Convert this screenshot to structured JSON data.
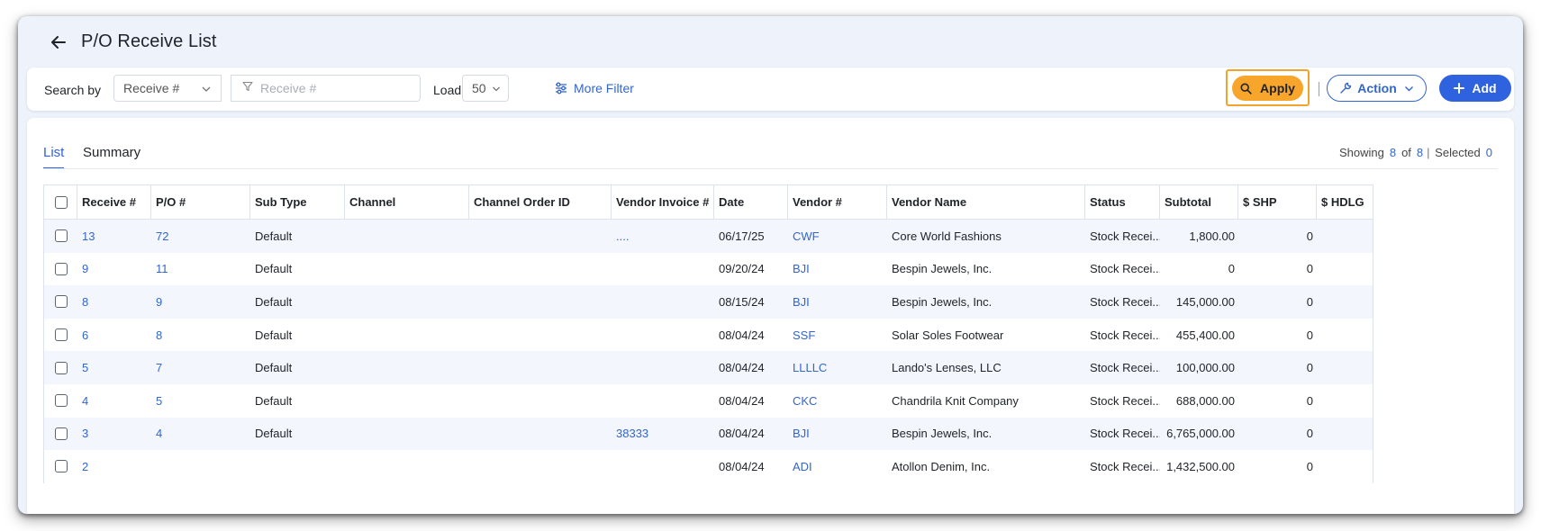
{
  "page": {
    "title": "P/O Receive List"
  },
  "toolbar": {
    "search_by_label": "Search by",
    "search_by_value": "Receive #",
    "search_placeholder": "Receive #",
    "load_label": "Load",
    "load_value": "50",
    "more_filter_label": "More Filter",
    "apply_label": "Apply",
    "action_label": "Action",
    "add_label": "Add"
  },
  "tabs": [
    {
      "label": "List"
    },
    {
      "label": "Summary"
    }
  ],
  "status": {
    "showing_label": "Showing",
    "showing_count": "8",
    "of_label": "of",
    "total_count": "8",
    "selected_label": "Selected",
    "selected_count": "0"
  },
  "table": {
    "columns": [
      "Receive #",
      "P/O #",
      "Sub Type",
      "Channel",
      "Channel Order ID",
      "Vendor Invoice #",
      "Date",
      "Vendor #",
      "Vendor Name",
      "Status",
      "Subtotal",
      "$ SHP",
      "$ HDLG"
    ],
    "rows": [
      {
        "receive": "13",
        "po": "72",
        "sub_type": "Default",
        "channel": "",
        "channel_order_id": "",
        "vendor_invoice": "....",
        "date": "06/17/25",
        "vendor_num": "CWF",
        "vendor_name": "Core World Fashions",
        "status": "Stock Recei...",
        "subtotal": "1,800.00",
        "shp": "0",
        "hdlg": ""
      },
      {
        "receive": "9",
        "po": "11",
        "sub_type": "Default",
        "channel": "",
        "channel_order_id": "",
        "vendor_invoice": "",
        "date": "09/20/24",
        "vendor_num": "BJI",
        "vendor_name": "Bespin Jewels, Inc.",
        "status": "Stock Recei...",
        "subtotal": "0",
        "shp": "0",
        "hdlg": ""
      },
      {
        "receive": "8",
        "po": "9",
        "sub_type": "Default",
        "channel": "",
        "channel_order_id": "",
        "vendor_invoice": "",
        "date": "08/15/24",
        "vendor_num": "BJI",
        "vendor_name": "Bespin Jewels, Inc.",
        "status": "Stock Recei...",
        "subtotal": "145,000.00",
        "shp": "0",
        "hdlg": ""
      },
      {
        "receive": "6",
        "po": "8",
        "sub_type": "Default",
        "channel": "",
        "channel_order_id": "",
        "vendor_invoice": "",
        "date": "08/04/24",
        "vendor_num": "SSF",
        "vendor_name": "Solar Soles Footwear",
        "status": "Stock Recei...",
        "subtotal": "455,400.00",
        "shp": "0",
        "hdlg": ""
      },
      {
        "receive": "5",
        "po": "7",
        "sub_type": "Default",
        "channel": "",
        "channel_order_id": "",
        "vendor_invoice": "",
        "date": "08/04/24",
        "vendor_num": "LLLLC",
        "vendor_name": "Lando's Lenses, LLC",
        "status": "Stock Recei...",
        "subtotal": "100,000.00",
        "shp": "0",
        "hdlg": ""
      },
      {
        "receive": "4",
        "po": "5",
        "sub_type": "Default",
        "channel": "",
        "channel_order_id": "",
        "vendor_invoice": "",
        "date": "08/04/24",
        "vendor_num": "CKC",
        "vendor_name": "Chandrila Knit Company",
        "status": "Stock Recei...",
        "subtotal": "688,000.00",
        "shp": "0",
        "hdlg": ""
      },
      {
        "receive": "3",
        "po": "4",
        "sub_type": "Default",
        "channel": "",
        "channel_order_id": "",
        "vendor_invoice": "38333",
        "date": "08/04/24",
        "vendor_num": "BJI",
        "vendor_name": "Bespin Jewels, Inc.",
        "status": "Stock Recei...",
        "subtotal": "6,765,000.00",
        "shp": "0",
        "hdlg": ""
      },
      {
        "receive": "2",
        "po": "",
        "sub_type": "",
        "channel": "",
        "channel_order_id": "",
        "vendor_invoice": "",
        "date": "08/04/24",
        "vendor_num": "ADI",
        "vendor_name": "Atollon Denim, Inc.",
        "status": "Stock Recei...",
        "subtotal": "1,432,500.00",
        "shp": "0",
        "hdlg": ""
      }
    ]
  },
  "colors": {
    "accent": "#2f62df",
    "link": "#3366cc",
    "apply": "#f8a52b",
    "row_alt": "#f3f6fc"
  }
}
